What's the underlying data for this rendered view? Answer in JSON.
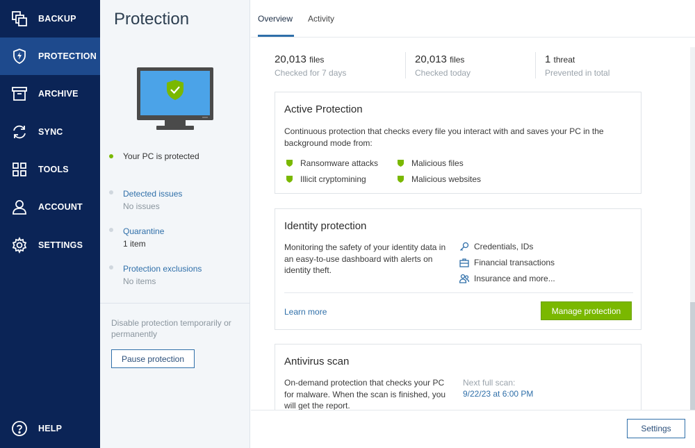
{
  "sidebar": {
    "items": [
      {
        "label": "BACKUP",
        "icon": "backup-icon"
      },
      {
        "label": "PROTECTION",
        "icon": "shield-bolt-icon",
        "active": true
      },
      {
        "label": "ARCHIVE",
        "icon": "archive-icon"
      },
      {
        "label": "SYNC",
        "icon": "sync-icon"
      },
      {
        "label": "TOOLS",
        "icon": "tools-grid-icon"
      },
      {
        "label": "ACCOUNT",
        "icon": "account-icon"
      },
      {
        "label": "SETTINGS",
        "icon": "gear-icon"
      }
    ],
    "help": {
      "label": "HELP",
      "icon": "help-icon"
    },
    "colors": {
      "background": "#0b2456",
      "active": "#1e4a8d"
    }
  },
  "panel": {
    "title": "Protection",
    "status": "Your PC is protected",
    "detected_issues": {
      "label": "Detected issues",
      "value": "No issues"
    },
    "quarantine": {
      "label": "Quarantine",
      "value": "1 item"
    },
    "exclusions": {
      "label": "Protection exclusions",
      "value": "No items"
    },
    "disable_note": "Disable protection temporarily or permanently",
    "pause_button": "Pause protection"
  },
  "tabs": [
    {
      "label": "Overview",
      "active": true
    },
    {
      "label": "Activity"
    }
  ],
  "stats": [
    {
      "number": "20,013",
      "unit": "files",
      "sub": "Checked for 7 days"
    },
    {
      "number": "20,013",
      "unit": "files",
      "sub": "Checked today"
    },
    {
      "number": "1",
      "unit": "threat",
      "sub": "Prevented in total"
    }
  ],
  "active_protection": {
    "title": "Active Protection",
    "description": "Continuous protection that checks every file you interact with and saves your PC in the background mode from:",
    "items": [
      "Ransomware attacks",
      "Malicious files",
      "Illicit cryptomining",
      "Malicious websites"
    ]
  },
  "identity_protection": {
    "title": "Identity protection",
    "description": "Monitoring the safety of your identity data in an easy-to-use dashboard with alerts on identity theft.",
    "items": [
      {
        "label": "Credentials, IDs",
        "icon": "key-icon"
      },
      {
        "label": "Financial transactions",
        "icon": "briefcase-icon"
      },
      {
        "label": "Insurance and more...",
        "icon": "people-icon"
      }
    ],
    "learn_more": "Learn more",
    "manage_button": "Manage protection"
  },
  "antivirus_scan": {
    "title": "Antivirus scan",
    "description": "On-demand protection that checks your PC for malware. When the scan is finished, you will get the report.",
    "next_scan_label": "Next full scan:",
    "next_scan_date": "9/22/23 at 6:00 PM"
  },
  "footer": {
    "settings_button": "Settings"
  },
  "accent_colors": {
    "green": "#7ab800",
    "link": "#2f6fa9"
  }
}
